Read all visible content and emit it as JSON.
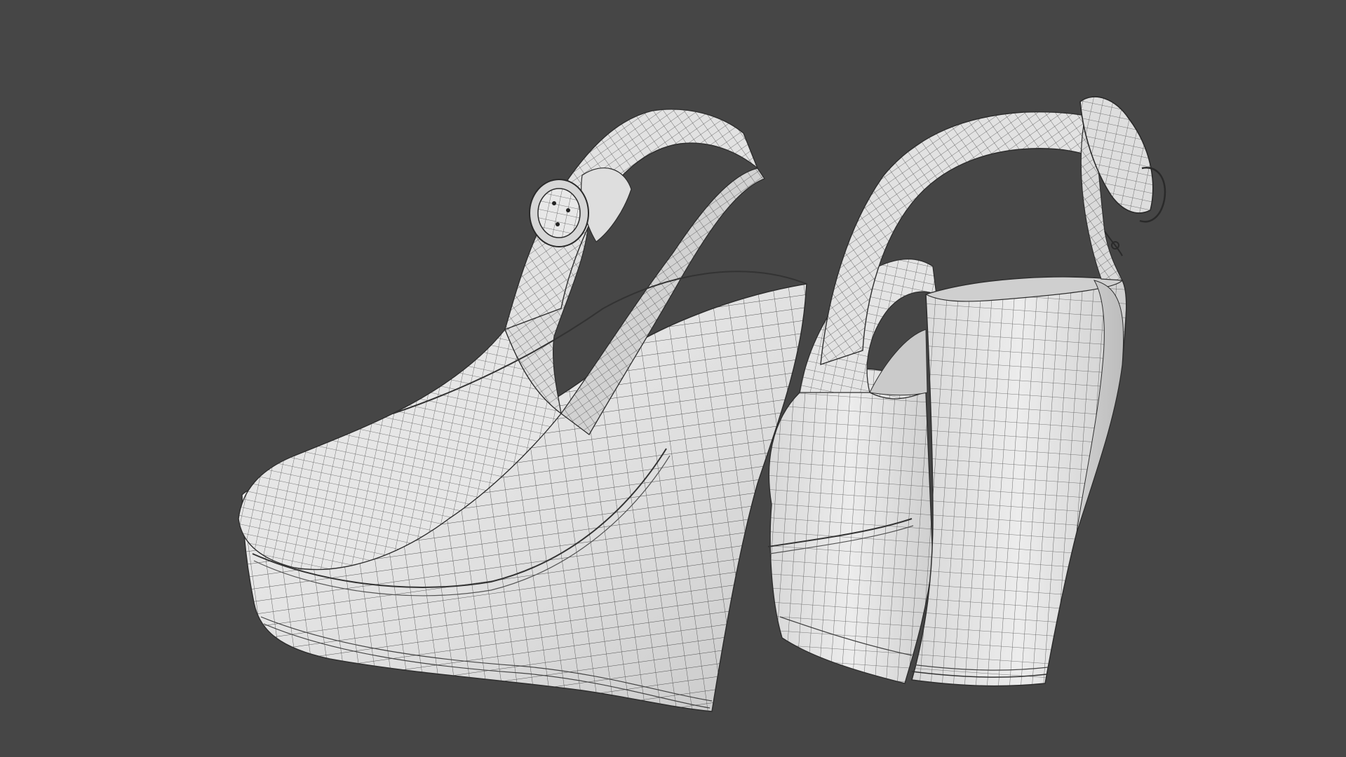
{
  "scene": {
    "background_color": "#464646",
    "model_surface_color": "#e4e4e4",
    "wire_color": "#3a3a3a",
    "shading_dark": "#b5b5b5",
    "objects": [
      {
        "name": "left-wedge-sandal",
        "display_mode": "wireframe-on-shaded"
      },
      {
        "name": "right-wedge-sandal",
        "display_mode": "wireframe-on-shaded"
      }
    ]
  }
}
